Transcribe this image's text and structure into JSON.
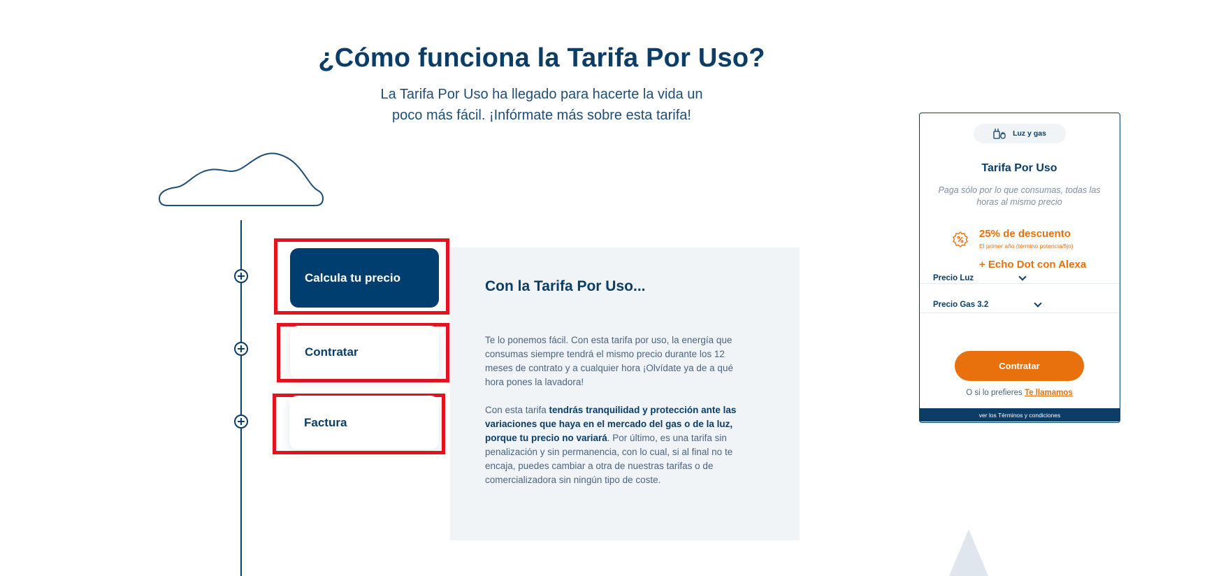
{
  "hero": {
    "title": "¿Cómo funciona la Tarifa Por Uso?",
    "subtitle_line1": "La Tarifa Por Uso ha llegado para hacerte la vida un",
    "subtitle_line2": "poco más fácil. ¡Infórmate más sobre esta tarifa!"
  },
  "steps": [
    {
      "label": "Calcula tu precio",
      "active": true
    },
    {
      "label": "Contratar",
      "active": false
    },
    {
      "label": "Factura",
      "active": false
    }
  ],
  "info": {
    "title": "Con la Tarifa Por Uso...",
    "p1": "Te lo ponemos fácil. Con esta tarifa por uso, la energía que consumas siempre tendrá el mismo precio durante los 12 meses de contrato y a cualquier hora ¡Olvídate ya de a qué hora pones la lavadora!",
    "p2_pre": "Con esta tarifa ",
    "p2_bold": "tendrás tranquilidad y protección ante las variaciones que haya en el mercado del gas o de la luz, porque tu precio no variará",
    "p2_post": ". Por último, es una tarifa sin penalización y sin permanencia, con lo cual, si al final no te encaja, puedes cambiar a otra de nuestras tarifas o de comercializadora sin ningún tipo de coste."
  },
  "card": {
    "pill": "Luz y gas",
    "pill_icon": "plug-flame-icon",
    "title": "Tarifa Por Uso",
    "description": "Paga sólo por lo que consumas, todas las horas al mismo precio",
    "discount_icon": "percent-badge-icon",
    "discount": "25% de descuento",
    "discount_note": "El primer año (término potencia/fijo)",
    "gift": "+ Echo Dot con Alexa",
    "dropdown_luz": "Precio Luz",
    "dropdown_gas": "Precio Gas 3.2",
    "cta": "Contratar",
    "callback_text": "O si lo prefieres",
    "callback_link": "Te llamamos",
    "terms": "ver los Términos y condiciones"
  },
  "colors": {
    "navy": "#0b3d67",
    "orange": "#e8700d",
    "highlight": "#e4141f",
    "panel_bg": "#f0f4f7"
  }
}
